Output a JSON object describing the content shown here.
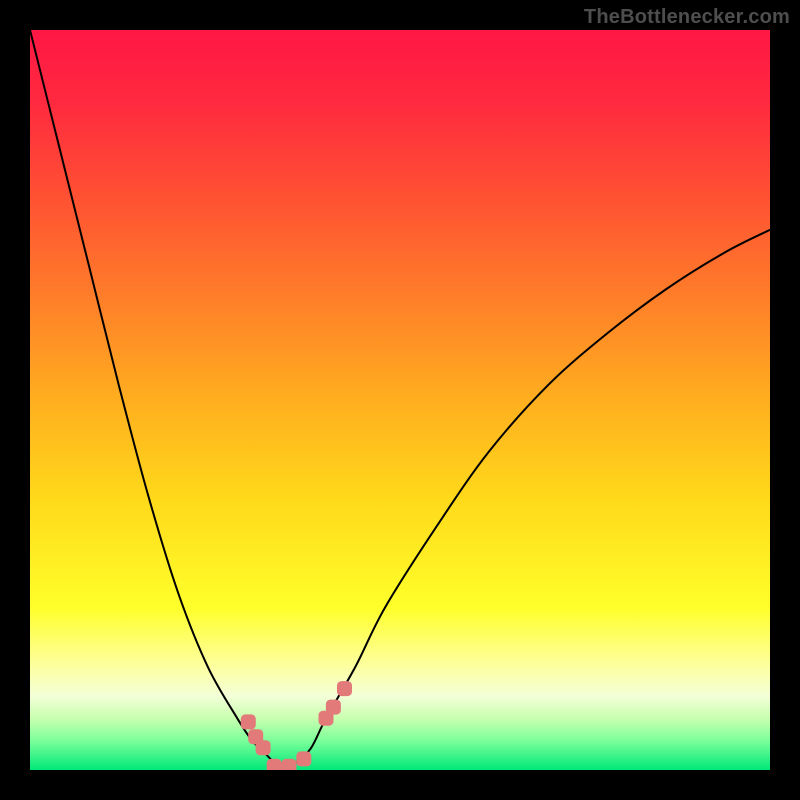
{
  "watermark": "TheBottlenecker.com",
  "colors": {
    "frame_bg": "#000000",
    "curve_stroke": "#000000",
    "marker_fill": "#e37a7a",
    "gradient_stops": [
      {
        "offset": 0.0,
        "color": "#ff1744"
      },
      {
        "offset": 0.1,
        "color": "#ff2a3f"
      },
      {
        "offset": 0.22,
        "color": "#ff4f33"
      },
      {
        "offset": 0.35,
        "color": "#ff7a2a"
      },
      {
        "offset": 0.5,
        "color": "#ffae1f"
      },
      {
        "offset": 0.63,
        "color": "#ffd81a"
      },
      {
        "offset": 0.78,
        "color": "#ffff2a"
      },
      {
        "offset": 0.86,
        "color": "#fdffa0"
      },
      {
        "offset": 0.9,
        "color": "#f3ffd8"
      },
      {
        "offset": 0.93,
        "color": "#c9ffb0"
      },
      {
        "offset": 0.96,
        "color": "#7dff9a"
      },
      {
        "offset": 1.0,
        "color": "#00e879"
      }
    ]
  },
  "chart_data": {
    "type": "line",
    "title": "",
    "xlabel": "",
    "ylabel": "",
    "x": [
      0.0,
      0.04,
      0.08,
      0.12,
      0.16,
      0.2,
      0.24,
      0.28,
      0.3,
      0.32,
      0.33,
      0.34,
      0.35,
      0.36,
      0.38,
      0.4,
      0.44,
      0.48,
      0.55,
      0.62,
      0.7,
      0.78,
      0.86,
      0.94,
      1.0
    ],
    "values": [
      1.0,
      0.84,
      0.68,
      0.52,
      0.37,
      0.24,
      0.14,
      0.07,
      0.04,
      0.02,
      0.01,
      0.0,
      0.0,
      0.01,
      0.03,
      0.07,
      0.14,
      0.22,
      0.33,
      0.43,
      0.52,
      0.59,
      0.65,
      0.7,
      0.73
    ],
    "xlim": [
      0,
      1
    ],
    "ylim": [
      0,
      1
    ],
    "markers": {
      "x": [
        0.295,
        0.305,
        0.315,
        0.33,
        0.35,
        0.37,
        0.4,
        0.41,
        0.425
      ],
      "y": [
        0.065,
        0.045,
        0.03,
        0.005,
        0.005,
        0.015,
        0.07,
        0.085,
        0.11
      ]
    }
  }
}
